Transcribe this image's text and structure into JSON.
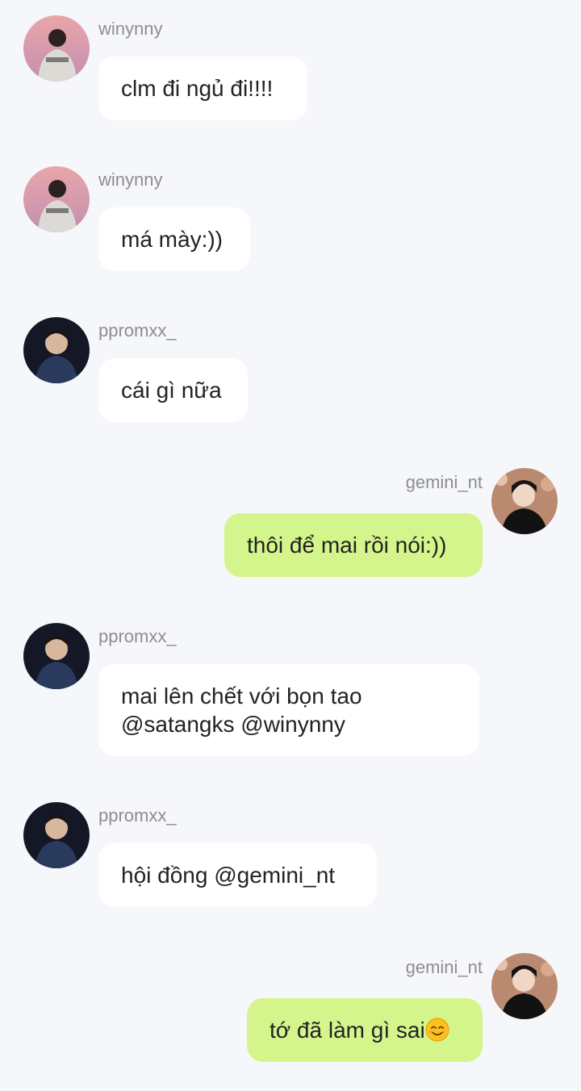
{
  "messages": [
    {
      "sender": "winynny",
      "direction": "in",
      "avatar": "avatar-winynny",
      "lines": [
        "clm đi ngủ đi!!!!"
      ]
    },
    {
      "sender": "winynny",
      "direction": "in",
      "avatar": "avatar-winynny",
      "lines": [
        "má mày:))"
      ]
    },
    {
      "sender": "ppromxx_",
      "direction": "in",
      "avatar": "avatar-ppromxx",
      "lines": [
        "cái gì nữa"
      ]
    },
    {
      "sender": "gemini_nt",
      "direction": "out",
      "avatar": "avatar-gemini",
      "lines": [
        "thôi để mai rồi nói:))"
      ]
    },
    {
      "sender": "ppromxx_",
      "direction": "in",
      "avatar": "avatar-ppromxx",
      "lines": [
        "mai lên chết với bọn tao",
        "@satangks @winynny"
      ]
    },
    {
      "sender": "ppromxx_",
      "direction": "in",
      "avatar": "avatar-ppromxx",
      "lines": [
        "hội đồng @gemini_nt"
      ]
    },
    {
      "sender": "gemini_nt",
      "direction": "out",
      "avatar": "avatar-gemini",
      "lines": [
        "tớ đã làm gì sai"
      ],
      "trailing_icon": "smiling-face-emoji-icon"
    }
  ],
  "colors": {
    "background": "#f5f7fa",
    "incoming_bubble": "#ffffff",
    "outgoing_bubble": "#d4f58c",
    "sender_name": "#8e8e8e",
    "message_text": "#222222"
  }
}
